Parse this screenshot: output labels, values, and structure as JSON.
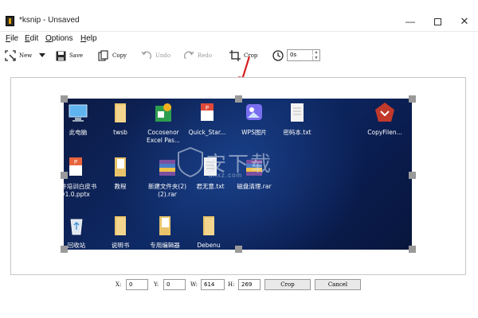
{
  "window": {
    "title": "*ksnip - Unsaved",
    "minimize": "—",
    "close": "✕"
  },
  "menu": [
    "File",
    "Edit",
    "Options",
    "Help"
  ],
  "toolbar": {
    "new_label": "New",
    "save_label": "Save",
    "copy_label": "Copy",
    "undo_label": "Undo",
    "redo_label": "Redo",
    "crop_label": "Crop",
    "delay_value": "0s"
  },
  "desktop_icons": [
    {
      "label": "此电脑",
      "icon": "computer-icon"
    },
    {
      "label": "twsb",
      "icon": "folder-icon"
    },
    {
      "label": "Cocosenor Excel Pas...",
      "icon": "excel-password-icon"
    },
    {
      "label": "Quick_Star...",
      "icon": "pdf-icon"
    },
    {
      "label": "WPS图片",
      "icon": "wps-image-icon"
    },
    {
      "label": "密码本.txt",
      "icon": "text-file-icon"
    },
    {
      "label": "CopyFilen...",
      "icon": "copyfilename-icon"
    },
    {
      "label": "文件培训白皮书v1.0.pptx",
      "icon": "pptx-icon"
    },
    {
      "label": "教程",
      "icon": "folder-docs-icon"
    },
    {
      "label": "新建文件夹(2)(2).rar",
      "icon": "rar-archive-icon"
    },
    {
      "label": "君无意.txt",
      "icon": "text-file-icon"
    },
    {
      "label": "磁盘清理.rar",
      "icon": "rar-archive-icon"
    },
    {
      "label": "回收站",
      "icon": "recycle-bin-icon"
    },
    {
      "label": "说明书",
      "icon": "folder-icon"
    },
    {
      "label": "专用编辑器",
      "icon": "folder-docs-icon"
    },
    {
      "label": "Debenu",
      "icon": "folder-icon"
    }
  ],
  "watermark": {
    "text": "安下载",
    "sub": "anxz.com"
  },
  "crop_panel": {
    "x_label": "X:",
    "x_value": "0",
    "y_label": "Y:",
    "y_value": "0",
    "w_label": "W:",
    "w_value": "614",
    "h_label": "H:",
    "h_value": "269",
    "crop_button": "Crop",
    "cancel_button": "Cancel"
  },
  "colors": {
    "desktop_bg": "#0e2a66",
    "handle": "#9a9a9a",
    "arrow": "#d62020"
  }
}
